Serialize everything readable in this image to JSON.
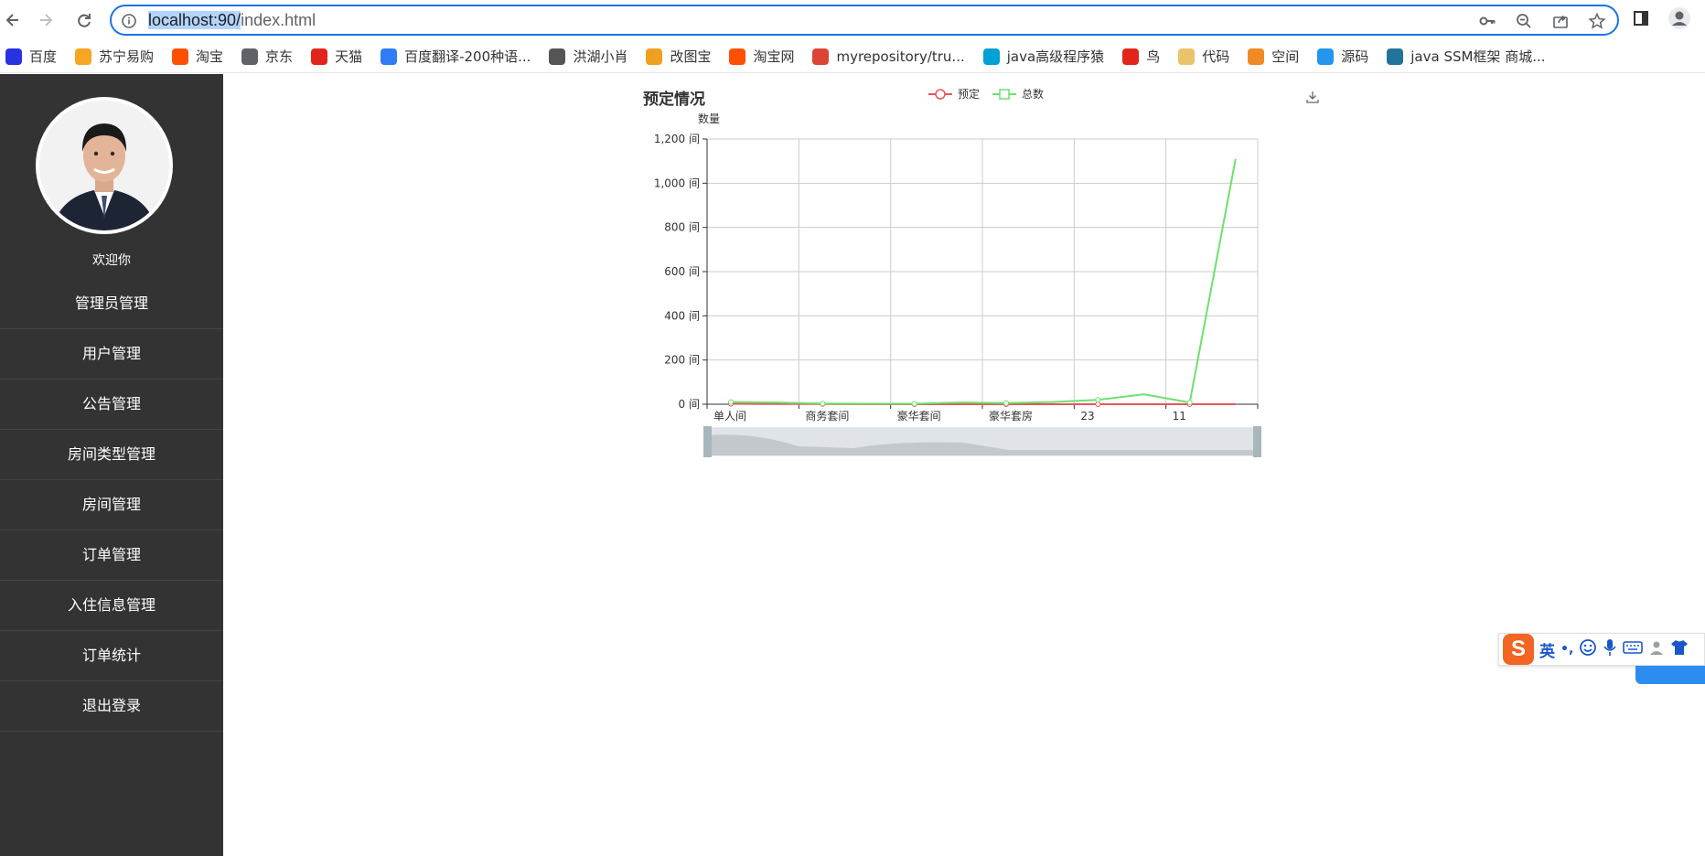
{
  "browser": {
    "url_host": "localhost:90/",
    "url_path": "index.html",
    "bookmarks": [
      {
        "label": "百度",
        "icon": "baidu-icon",
        "color": "#2932e1"
      },
      {
        "label": "苏宁易购",
        "icon": "suning-icon",
        "color": "#f5a623"
      },
      {
        "label": "淘宝",
        "icon": "taobao-icon",
        "color": "#ff5000"
      },
      {
        "label": "京东",
        "icon": "globe-icon",
        "color": "#5f6368"
      },
      {
        "label": "天猫",
        "icon": "tmall-icon",
        "color": "#e1251b"
      },
      {
        "label": "百度翻译-200种语...",
        "icon": "translate-icon",
        "color": "#2f7cf6"
      },
      {
        "label": "洪湖小肖",
        "icon": "bird-icon",
        "color": "#555555"
      },
      {
        "label": "改图宝",
        "icon": "image-tool-icon",
        "color": "#f0a020"
      },
      {
        "label": "淘宝网",
        "icon": "taobao-icon",
        "color": "#ff5000"
      },
      {
        "label": "myrepository/tru...",
        "icon": "chrome-icon",
        "color": "#db4437"
      },
      {
        "label": "java高级程序猿",
        "icon": "bilibili-icon",
        "color": "#00a1d6"
      },
      {
        "label": "鸟",
        "icon": "bird-icon",
        "color": "#e1251b"
      },
      {
        "label": "代码",
        "icon": "code-icon",
        "color": "#e9c46a"
      },
      {
        "label": "空间",
        "icon": "qzone-icon",
        "color": "#f08a24"
      },
      {
        "label": "源码",
        "icon": "docker-icon",
        "color": "#2496ed"
      },
      {
        "label": "java SSM框架 商城...",
        "icon": "wordpress-icon",
        "color": "#21759b"
      }
    ]
  },
  "sidebar": {
    "welcome": "欢迎你",
    "items": [
      {
        "label": "管理员管理"
      },
      {
        "label": "用户管理"
      },
      {
        "label": "公告管理"
      },
      {
        "label": "房间类型管理"
      },
      {
        "label": "房间管理"
      },
      {
        "label": "订单管理"
      },
      {
        "label": "入住信息管理"
      },
      {
        "label": "订单统计"
      },
      {
        "label": "退出登录"
      }
    ]
  },
  "chart_header": {
    "title": "预定情况",
    "legend_booked": "预定",
    "legend_total": "总数",
    "ylabel": "数量"
  },
  "ime": {
    "label": "英",
    "punct": "•,"
  },
  "colors": {
    "sidebar_bg": "#333333",
    "booked": "#e8545d",
    "total": "#6ee06e",
    "accent": "#1a73e8"
  },
  "chart_data": {
    "type": "line",
    "title": "预定情况",
    "ylabel": "数量",
    "xlabel": "",
    "ylim": [
      0,
      1200
    ],
    "y_ticks": [
      "0 间",
      "200 间",
      "400 间",
      "600 间",
      "800 间",
      "1,000 间",
      "1,200 间"
    ],
    "x": [
      "单人间",
      "",
      "商务套间",
      "",
      "豪华套间",
      "",
      "豪华套房",
      "",
      "23",
      "",
      "11",
      ""
    ],
    "x_tick_labels": [
      "单人间",
      "商务套间",
      "豪华套间",
      "豪华套房",
      "23",
      "11"
    ],
    "series": [
      {
        "name": "预定",
        "values": [
          2,
          1,
          1,
          0,
          0,
          0,
          0,
          0,
          0,
          0,
          0,
          0
        ]
      },
      {
        "name": "总数",
        "values": [
          10,
          8,
          3,
          2,
          2,
          8,
          5,
          10,
          20,
          45,
          8,
          1110
        ]
      }
    ],
    "grid": true,
    "legend": "top-center",
    "data_zoom": true
  }
}
